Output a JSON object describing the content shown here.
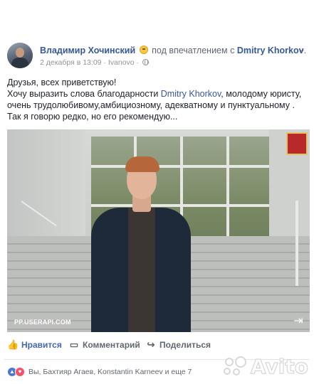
{
  "post": {
    "author": "Владимир Хочинский",
    "feeling": "под впечатлением с",
    "tagged": "Dmitry Khorkov",
    "date": "2 декабря в 13:09",
    "location": "Ivanovo",
    "text_line1": "Друзья, всех приветствую!",
    "text_line2_a": "Хочу выразить слова благодарности ",
    "text_line2_mention": "Dmitry Khorkov",
    "text_line2_b": ", молодому юристу,",
    "text_line3": "очень трудолюбивому,амбициозному, адекватному и пунктуальному .",
    "text_line4": "Так я говорю редко, но его рекомендую...",
    "photo_watermark": "PP.USERAPI.COM"
  },
  "actions": {
    "like_label": "Нравится",
    "comment_label": "Комментарий",
    "share_label": "Поделиться"
  },
  "reactions": {
    "summary": "Вы, Бахтияр Агаев, Konstantin Karneev и еще 7"
  },
  "watermark": {
    "brand": "Avito"
  },
  "colors": {
    "link": "#365899",
    "like_active": "#4267b2",
    "meta": "#90949c"
  },
  "icons": [
    "smile-emoji-icon",
    "globe-icon",
    "chevron-down-icon",
    "share-out-icon",
    "like-icon",
    "comment-icon",
    "share-icon",
    "react-like-icon",
    "react-love-icon"
  ]
}
